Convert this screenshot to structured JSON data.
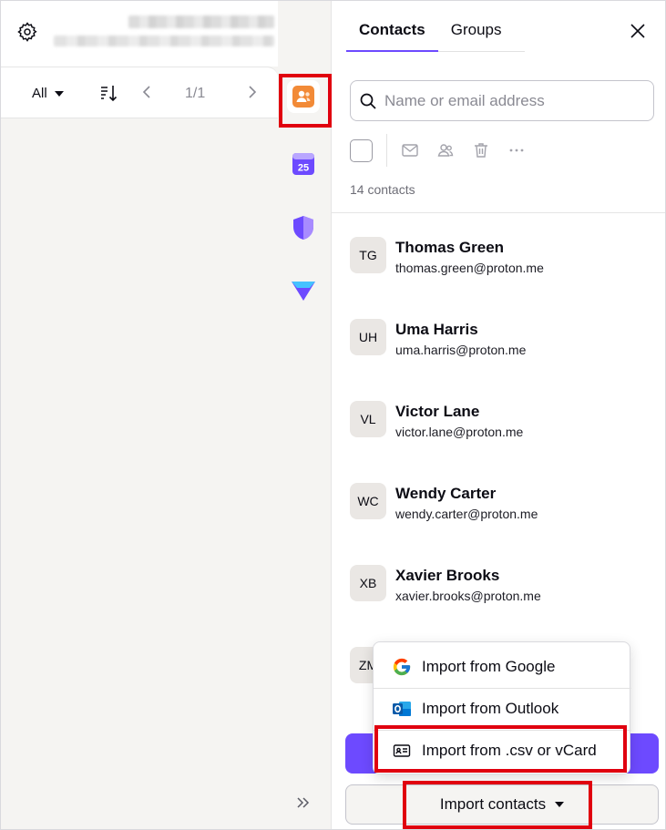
{
  "left_pane": {
    "filter_label": "All",
    "pagination": "1/1"
  },
  "panel": {
    "tabs": [
      {
        "label": "Contacts"
      },
      {
        "label": "Groups"
      }
    ],
    "search_placeholder": "Name or email address",
    "contact_count": "14 contacts",
    "contacts": [
      {
        "initials": "TG",
        "name": "Thomas Green",
        "email": "thomas.green@proton.me"
      },
      {
        "initials": "UH",
        "name": "Uma Harris",
        "email": "uma.harris@proton.me"
      },
      {
        "initials": "VL",
        "name": "Victor Lane",
        "email": "victor.lane@proton.me"
      },
      {
        "initials": "WC",
        "name": "Wendy Carter",
        "email": "wendy.carter@proton.me"
      },
      {
        "initials": "XB",
        "name": "Xavier Brooks",
        "email": "xavier.brooks@proton.me"
      },
      {
        "initials": "ZM",
        "name": "",
        "email": ""
      }
    ],
    "import_button_label": "Import contacts"
  },
  "import_menu": {
    "items": [
      {
        "label": "Import from Google",
        "icon": "google-icon"
      },
      {
        "label": "Import from Outlook",
        "icon": "outlook-icon"
      },
      {
        "label": "Import from .csv or vCard",
        "icon": "id-card-icon"
      }
    ]
  },
  "rail": {
    "apps": [
      {
        "icon": "contacts-icon",
        "active": true
      },
      {
        "icon": "calendar-icon",
        "label": "25"
      },
      {
        "icon": "vpn-shield-icon"
      },
      {
        "icon": "drive-icon"
      }
    ]
  },
  "colors": {
    "accent": "#6d4aff",
    "highlight": "#e0000f",
    "contacts_orange": "#f28a37"
  }
}
